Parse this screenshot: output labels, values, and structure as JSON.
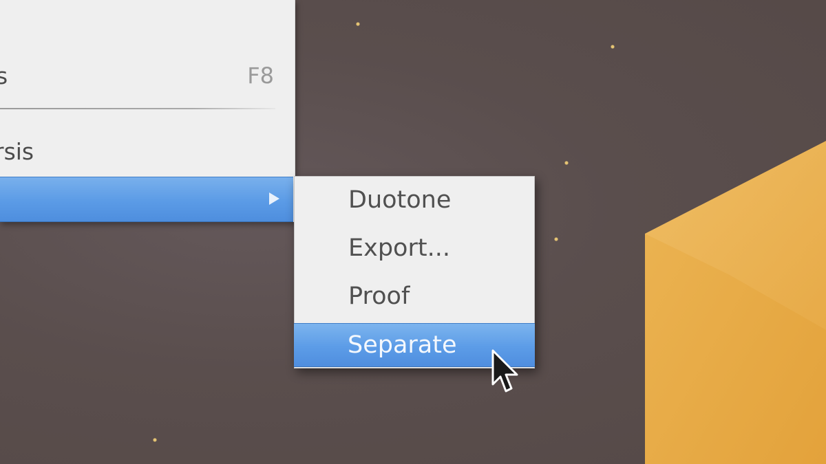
{
  "main_menu": {
    "item_partial_1": {
      "label": "s",
      "shortcut": "F8"
    },
    "item_partial_2": {
      "label": "rsis"
    },
    "highlighted_item": {
      "arrow_icon": "submenu-arrow-icon"
    }
  },
  "submenu": {
    "items": [
      {
        "label": "Duotone"
      },
      {
        "label": "Export..."
      },
      {
        "label": "Proof"
      },
      {
        "label": "Separate",
        "selected": true
      }
    ]
  },
  "colors": {
    "selection": "#5b9be6",
    "menu_background": "#efefef",
    "desktop": "#5b4f4d",
    "accent_shape": "#e3a640"
  },
  "cursor": {
    "icon": "pointer-arrow-icon"
  }
}
